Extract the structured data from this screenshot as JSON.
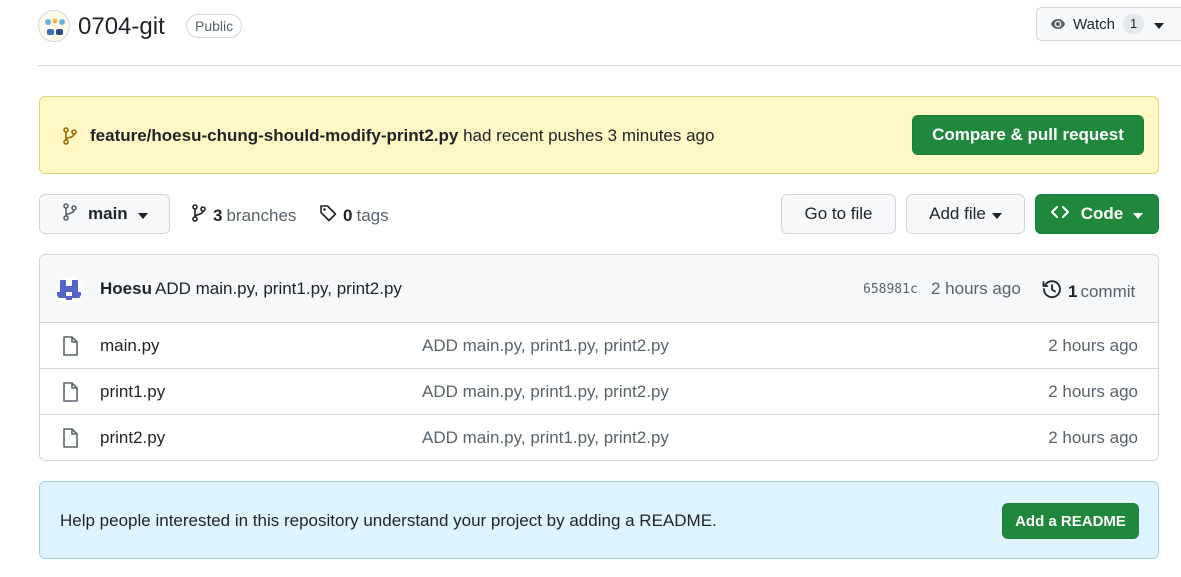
{
  "repo": {
    "name": "0704-git",
    "visibility": "Public",
    "watch_label": "Watch",
    "watch_count": "1"
  },
  "banner": {
    "branch": "feature/hoesu-chung-should-modify-print2.py",
    "message": "had recent pushes 3 minutes ago",
    "button": "Compare & pull request"
  },
  "toolbar": {
    "branch": "main",
    "branches_count": "3",
    "branches_label": "branches",
    "tags_count": "0",
    "tags_label": "tags",
    "goto_file": "Go to file",
    "add_file": "Add file",
    "code": "Code"
  },
  "latest_commit": {
    "author": "Hoesu",
    "message": "ADD main.py, print1.py, print2.py",
    "sha": "658981c",
    "time": "2 hours ago",
    "count": "1",
    "count_label": "commit"
  },
  "files": [
    {
      "name": "main.py",
      "message": "ADD main.py, print1.py, print2.py",
      "time": "2 hours ago"
    },
    {
      "name": "print1.py",
      "message": "ADD main.py, print1.py, print2.py",
      "time": "2 hours ago"
    },
    {
      "name": "print2.py",
      "message": "ADD main.py, print1.py, print2.py",
      "time": "2 hours ago"
    }
  ],
  "readme": {
    "message": "Help people interested in this repository understand your project by adding a README.",
    "button": "Add a README"
  },
  "colors": {
    "primary_green": "#1f883d",
    "banner_bg": "#fff8c5",
    "info_bg": "#ddf4ff",
    "branch_icon": "#9a6700"
  },
  "icons": [
    "owner-avatar",
    "eye-icon",
    "chevron-down-icon",
    "git-branch-icon",
    "tag-icon",
    "code-icon",
    "history-icon",
    "file-icon",
    "identicon-avatar"
  ]
}
